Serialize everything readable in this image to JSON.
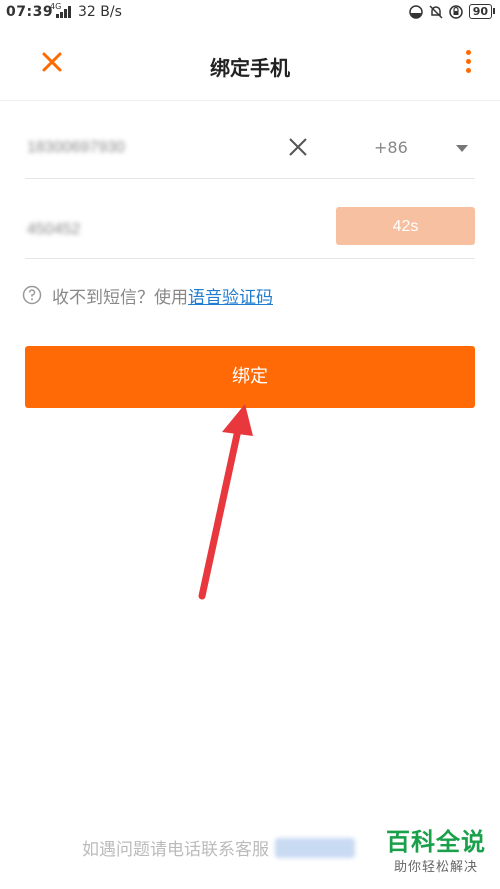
{
  "status_bar": {
    "time": "07:39",
    "network": "4G",
    "speed": "32 B/s",
    "battery": "90"
  },
  "header": {
    "title": "绑定手机"
  },
  "form": {
    "phone_value": "18300697930",
    "country_code": "+86",
    "code_value": "450452",
    "countdown_label": "42s"
  },
  "help": {
    "prefix": "收不到短信？使用",
    "link": "语音验证码"
  },
  "bind_button": "绑定",
  "footer": {
    "text": "如遇问题请电话联系客服"
  },
  "watermark": {
    "title": "百科全说",
    "subtitle": "助你轻松解决"
  },
  "colors": {
    "accent": "#ff6a06",
    "countdown_bg": "#f7c0a0",
    "link": "#1f7ccf",
    "arrow": "#e8383d",
    "watermark_green": "#1aa04a"
  }
}
